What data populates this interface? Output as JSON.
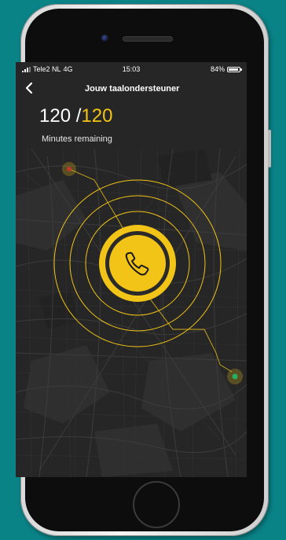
{
  "status_bar": {
    "carrier": "Tele2 NL",
    "network": "4G",
    "time": "15:03",
    "battery": "84%"
  },
  "header": {
    "back_icon": "chevron-left-icon",
    "title": "Jouw taalondersteuner"
  },
  "minutes": {
    "used": "120",
    "separator": "/",
    "total": "120",
    "label": "Minutes remaining"
  },
  "call": {
    "icon": "phone-icon",
    "accent_color": "#f2c417"
  },
  "colors": {
    "background": "#0a8387",
    "accent": "#f2c417",
    "map": "#262626",
    "marker_red": "#c0392b",
    "marker_green": "#27ae60"
  }
}
